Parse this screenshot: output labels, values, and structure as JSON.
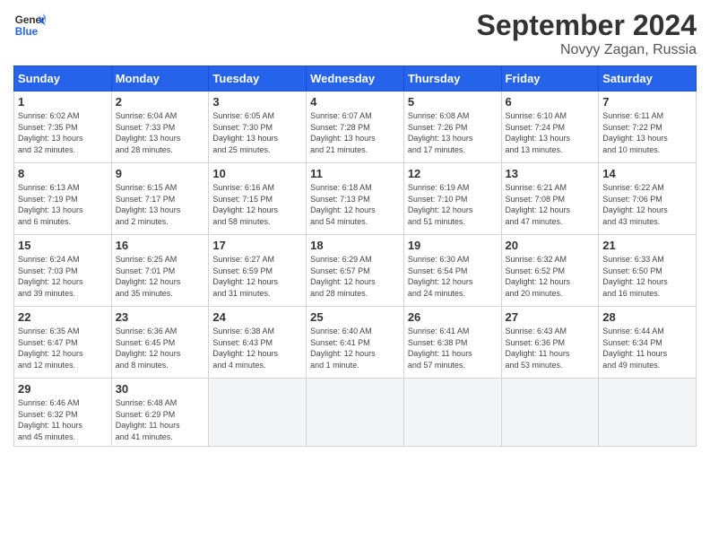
{
  "header": {
    "logo_general": "General",
    "logo_blue": "Blue",
    "month": "September 2024",
    "location": "Novyy Zagan, Russia"
  },
  "days_of_week": [
    "Sunday",
    "Monday",
    "Tuesday",
    "Wednesday",
    "Thursday",
    "Friday",
    "Saturday"
  ],
  "weeks": [
    [
      {
        "day": "1",
        "info": "Sunrise: 6:02 AM\nSunset: 7:35 PM\nDaylight: 13 hours\nand 32 minutes."
      },
      {
        "day": "2",
        "info": "Sunrise: 6:04 AM\nSunset: 7:33 PM\nDaylight: 13 hours\nand 28 minutes."
      },
      {
        "day": "3",
        "info": "Sunrise: 6:05 AM\nSunset: 7:30 PM\nDaylight: 13 hours\nand 25 minutes."
      },
      {
        "day": "4",
        "info": "Sunrise: 6:07 AM\nSunset: 7:28 PM\nDaylight: 13 hours\nand 21 minutes."
      },
      {
        "day": "5",
        "info": "Sunrise: 6:08 AM\nSunset: 7:26 PM\nDaylight: 13 hours\nand 17 minutes."
      },
      {
        "day": "6",
        "info": "Sunrise: 6:10 AM\nSunset: 7:24 PM\nDaylight: 13 hours\nand 13 minutes."
      },
      {
        "day": "7",
        "info": "Sunrise: 6:11 AM\nSunset: 7:22 PM\nDaylight: 13 hours\nand 10 minutes."
      }
    ],
    [
      {
        "day": "8",
        "info": "Sunrise: 6:13 AM\nSunset: 7:19 PM\nDaylight: 13 hours\nand 6 minutes."
      },
      {
        "day": "9",
        "info": "Sunrise: 6:15 AM\nSunset: 7:17 PM\nDaylight: 13 hours\nand 2 minutes."
      },
      {
        "day": "10",
        "info": "Sunrise: 6:16 AM\nSunset: 7:15 PM\nDaylight: 12 hours\nand 58 minutes."
      },
      {
        "day": "11",
        "info": "Sunrise: 6:18 AM\nSunset: 7:13 PM\nDaylight: 12 hours\nand 54 minutes."
      },
      {
        "day": "12",
        "info": "Sunrise: 6:19 AM\nSunset: 7:10 PM\nDaylight: 12 hours\nand 51 minutes."
      },
      {
        "day": "13",
        "info": "Sunrise: 6:21 AM\nSunset: 7:08 PM\nDaylight: 12 hours\nand 47 minutes."
      },
      {
        "day": "14",
        "info": "Sunrise: 6:22 AM\nSunset: 7:06 PM\nDaylight: 12 hours\nand 43 minutes."
      }
    ],
    [
      {
        "day": "15",
        "info": "Sunrise: 6:24 AM\nSunset: 7:03 PM\nDaylight: 12 hours\nand 39 minutes."
      },
      {
        "day": "16",
        "info": "Sunrise: 6:25 AM\nSunset: 7:01 PM\nDaylight: 12 hours\nand 35 minutes."
      },
      {
        "day": "17",
        "info": "Sunrise: 6:27 AM\nSunset: 6:59 PM\nDaylight: 12 hours\nand 31 minutes."
      },
      {
        "day": "18",
        "info": "Sunrise: 6:29 AM\nSunset: 6:57 PM\nDaylight: 12 hours\nand 28 minutes."
      },
      {
        "day": "19",
        "info": "Sunrise: 6:30 AM\nSunset: 6:54 PM\nDaylight: 12 hours\nand 24 minutes."
      },
      {
        "day": "20",
        "info": "Sunrise: 6:32 AM\nSunset: 6:52 PM\nDaylight: 12 hours\nand 20 minutes."
      },
      {
        "day": "21",
        "info": "Sunrise: 6:33 AM\nSunset: 6:50 PM\nDaylight: 12 hours\nand 16 minutes."
      }
    ],
    [
      {
        "day": "22",
        "info": "Sunrise: 6:35 AM\nSunset: 6:47 PM\nDaylight: 12 hours\nand 12 minutes."
      },
      {
        "day": "23",
        "info": "Sunrise: 6:36 AM\nSunset: 6:45 PM\nDaylight: 12 hours\nand 8 minutes."
      },
      {
        "day": "24",
        "info": "Sunrise: 6:38 AM\nSunset: 6:43 PM\nDaylight: 12 hours\nand 4 minutes."
      },
      {
        "day": "25",
        "info": "Sunrise: 6:40 AM\nSunset: 6:41 PM\nDaylight: 12 hours\nand 1 minute."
      },
      {
        "day": "26",
        "info": "Sunrise: 6:41 AM\nSunset: 6:38 PM\nDaylight: 11 hours\nand 57 minutes."
      },
      {
        "day": "27",
        "info": "Sunrise: 6:43 AM\nSunset: 6:36 PM\nDaylight: 11 hours\nand 53 minutes."
      },
      {
        "day": "28",
        "info": "Sunrise: 6:44 AM\nSunset: 6:34 PM\nDaylight: 11 hours\nand 49 minutes."
      }
    ],
    [
      {
        "day": "29",
        "info": "Sunrise: 6:46 AM\nSunset: 6:32 PM\nDaylight: 11 hours\nand 45 minutes."
      },
      {
        "day": "30",
        "info": "Sunrise: 6:48 AM\nSunset: 6:29 PM\nDaylight: 11 hours\nand 41 minutes."
      },
      {
        "day": "",
        "info": ""
      },
      {
        "day": "",
        "info": ""
      },
      {
        "day": "",
        "info": ""
      },
      {
        "day": "",
        "info": ""
      },
      {
        "day": "",
        "info": ""
      }
    ]
  ]
}
